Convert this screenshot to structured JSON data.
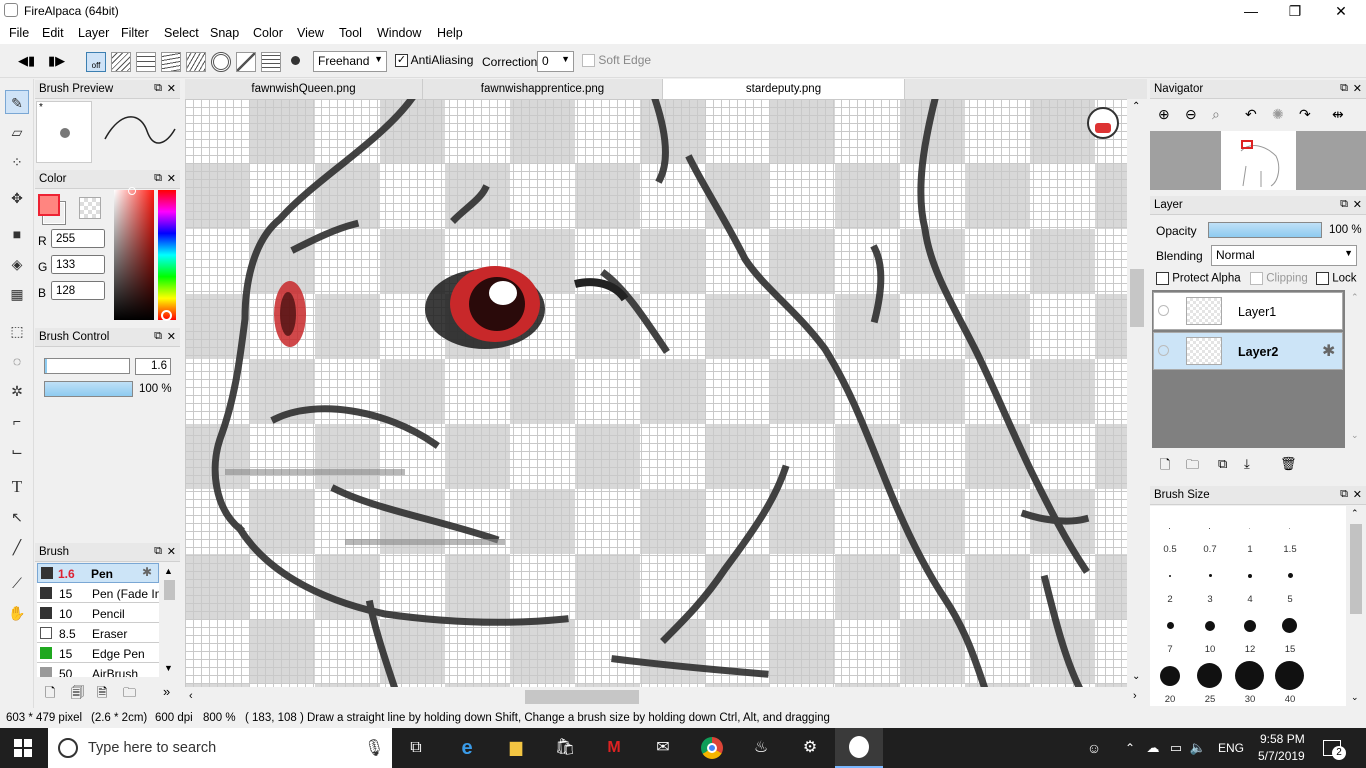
{
  "window": {
    "title": "FireAlpaca (64bit)"
  },
  "menu": [
    "File",
    "Edit",
    "Layer",
    "Filter",
    "Select",
    "Snap",
    "Color",
    "View",
    "Tool",
    "Window",
    "Help"
  ],
  "toolbar": {
    "mode_select": "Freehand",
    "antialiasing_label": "AntiAliasing",
    "antialiasing_checked": true,
    "correction_label": "Correction",
    "correction_value": "0",
    "soft_edge_label": "Soft Edge",
    "off_label": "off"
  },
  "panels": {
    "brush_preview": {
      "title": "Brush Preview",
      "star": "*"
    },
    "color": {
      "title": "Color",
      "r_label": "R",
      "g_label": "G",
      "b_label": "B",
      "r": "255",
      "g": "133",
      "b": "128",
      "fg_color": "#ff8580"
    },
    "brush_control": {
      "title": "Brush Control",
      "size": "1.6",
      "opacity": "100 %"
    },
    "brush": {
      "title": "Brush",
      "items": [
        {
          "size": "1.6",
          "name": "Pen",
          "selected": true
        },
        {
          "size": "15",
          "name": "Pen (Fade In)"
        },
        {
          "size": "10",
          "name": "Pencil"
        },
        {
          "size": "8.5",
          "name": "Eraser"
        },
        {
          "size": "15",
          "name": "Edge Pen"
        },
        {
          "size": "50",
          "name": "AirBrush"
        }
      ]
    },
    "navigator": {
      "title": "Navigator"
    },
    "layer": {
      "title": "Layer",
      "opacity_label": "Opacity",
      "opacity_value": "100 %",
      "blending_label": "Blending",
      "blending_value": "Normal",
      "protect_alpha_label": "Protect Alpha",
      "clipping_label": "Clipping",
      "lock_label": "Lock",
      "layers": [
        {
          "name": "Layer1",
          "selected": false
        },
        {
          "name": "Layer2",
          "selected": true
        }
      ]
    },
    "brush_size": {
      "title": "Brush Size",
      "sizes": [
        "0.5",
        "0.7",
        "1",
        "1.5",
        "2",
        "3",
        "4",
        "5",
        "7",
        "10",
        "12",
        "15",
        "20",
        "25",
        "30",
        "40"
      ]
    }
  },
  "tabs": [
    "fawnwishQueen.png",
    "fawnwishapprentice.png",
    "stardeputy.png"
  ],
  "active_tab": 2,
  "status": {
    "dimensions": "603 * 479 pixel",
    "size_cm": "(2.6 * 2cm)",
    "dpi": "600 dpi",
    "zoom": "800 %",
    "cursor": "( 183, 108 )",
    "hint": "Draw a straight line by holding down Shift, Change a brush size by holding down Ctrl, Alt, and dragging"
  },
  "taskbar": {
    "search_placeholder": "Type here to search",
    "language": "ENG",
    "time": "9:58 PM",
    "date": "5/7/2019",
    "notification_count": "2"
  }
}
